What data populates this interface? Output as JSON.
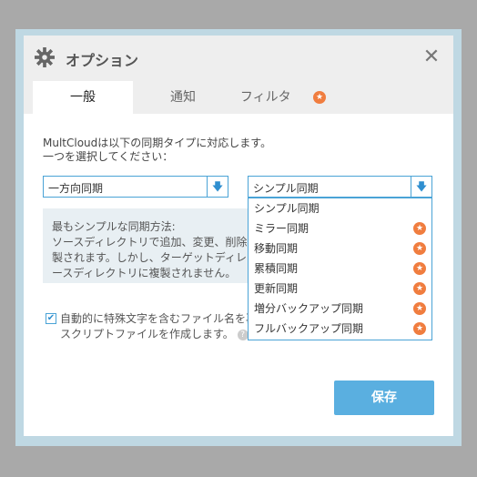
{
  "dialog": {
    "title": "オプション",
    "close_glyph": "✕",
    "tabs": [
      {
        "label": "一般",
        "active": true
      },
      {
        "label": "通知",
        "active": false
      },
      {
        "label": "フィルタ",
        "active": false,
        "premium": true
      }
    ],
    "description_line1": "MultCloudは以下の同期タイプに対応します。",
    "description_line2": "一つを選択してください：",
    "sync_direction_select": {
      "value": "一方向同期"
    },
    "sync_type_select": {
      "value": "シンプル同期"
    },
    "info_lines": [
      "最もシンプルな同期方法:",
      "ソースディレクトリで追加、変更、削除され",
      "製されます。しかし、ターゲットディレクトリで",
      "ースディレクトリに複製されません。"
    ],
    "auto_rename": {
      "checked": true,
      "line1": "自動的に特殊文字を含むファイル名を再",
      "line2": "スクリプトファイルを作成します。",
      "help_glyph": "?"
    },
    "dropdown_options": [
      {
        "label": "シンプル同期",
        "premium": false
      },
      {
        "label": "ミラー同期",
        "premium": true
      },
      {
        "label": "移動同期",
        "premium": true
      },
      {
        "label": "累積同期",
        "premium": true
      },
      {
        "label": "更新同期",
        "premium": true
      },
      {
        "label": "増分バックアップ同期",
        "premium": true
      },
      {
        "label": "フルバックアップ同期",
        "premium": true
      }
    ],
    "save_label": "保存",
    "star_glyph": "★",
    "arrow_glyph": "🡇",
    "check_glyph": "✔"
  },
  "colors": {
    "accent": "#4aa3d6",
    "premium_star": "#f07d3f",
    "save_button": "#5aafe0"
  }
}
